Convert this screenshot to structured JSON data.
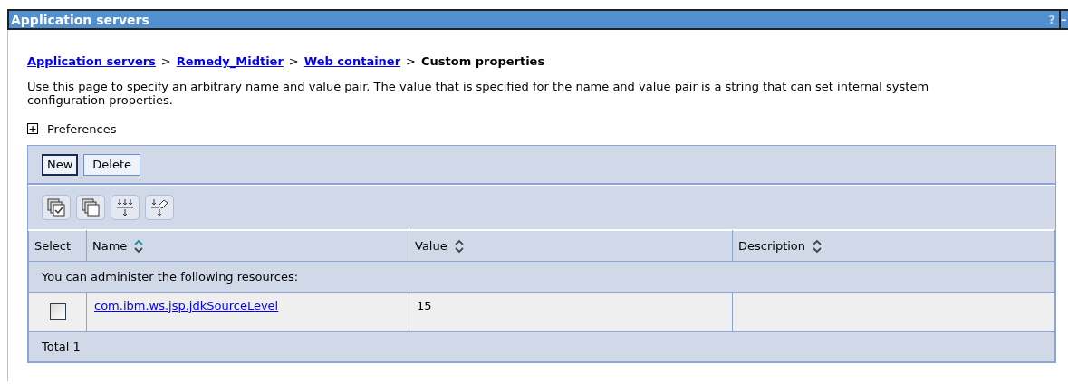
{
  "window": {
    "title": "Application servers",
    "buttons": [
      "?",
      "–"
    ]
  },
  "breadcrumb": {
    "links": [
      "Application servers",
      "Remedy_Midtier",
      "Web container"
    ],
    "separator": ">",
    "current": "Custom properties"
  },
  "description": "Use this page to specify an arbitrary name and value pair. The value that is specified for the name and value pair is a string that can set internal system configuration properties.",
  "preferences": {
    "label": "Preferences",
    "expanded": false,
    "toggle": "+"
  },
  "actions": [
    {
      "label": "New",
      "selected": true
    },
    {
      "label": "Delete",
      "selected": false
    }
  ],
  "table": {
    "columns": [
      {
        "label": "Select",
        "sortable": false
      },
      {
        "label": "Name",
        "sortable": true,
        "sorted": true
      },
      {
        "label": "Value",
        "sortable": true,
        "sorted": false
      },
      {
        "label": "Description",
        "sortable": true,
        "sorted": false
      }
    ],
    "notice": "You can administer the following resources:",
    "rows": [
      {
        "checked": false,
        "name": "com.ibm.ws.jsp.jdkSourceLevel",
        "value": "15"
      }
    ],
    "total": "Total 1"
  }
}
